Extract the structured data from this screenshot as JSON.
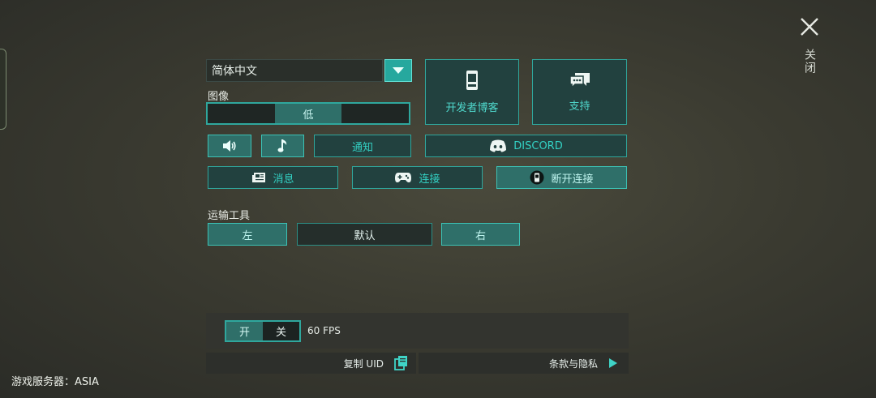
{
  "language": {
    "selected": "简体中文"
  },
  "graphics": {
    "label": "图像",
    "quality": "低"
  },
  "links": {
    "dev_blog": "开发者博客",
    "support": "支持",
    "discord": "DISCORD"
  },
  "buttons": {
    "notify": "通知",
    "news": "消息",
    "connect": "连接",
    "disconnect": "断开连接"
  },
  "vehicle": {
    "label": "运输工具",
    "left": "左",
    "default": "默认",
    "right": "右"
  },
  "fps": {
    "on": "开",
    "off": "关",
    "value": "60 FPS"
  },
  "footer": {
    "copy_uid": "复制 UID",
    "terms": "条款与隐私"
  },
  "server": {
    "label": "游戏服务器：ASIA"
  },
  "close": {
    "label": "关闭"
  },
  "colors": {
    "accent": "#2fa79d",
    "accent_fill": "#2f6f69",
    "accent_text": "#33d1c4"
  }
}
